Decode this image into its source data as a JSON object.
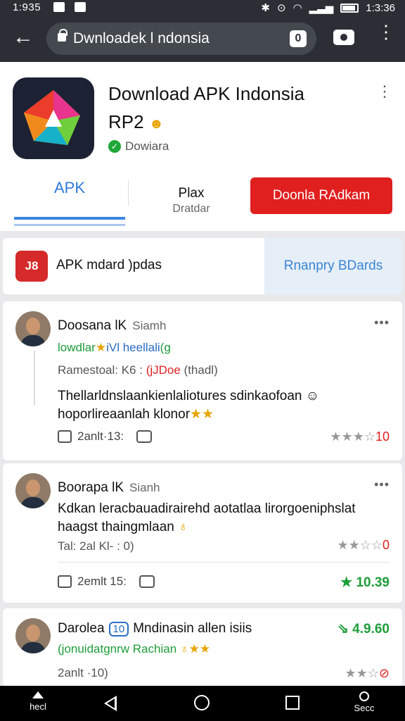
{
  "status_bar": {
    "time_left": "1:935",
    "time_right": "1:3:36"
  },
  "browser": {
    "url": "Dwnloadek l ndonsia",
    "tab_count": "0"
  },
  "app": {
    "title": "Download APK Indonsia",
    "subtitle": "RP2",
    "verified": "Dowiara",
    "tab_apk": "APK",
    "tab_mid_1": "Plax",
    "tab_mid_2": "Dratdar",
    "download_label": "Doonla RAdkam"
  },
  "update": {
    "icon_text": "J8",
    "text": "APK mdard )pdas",
    "action": "Rnanpry BDards"
  },
  "reviews": [
    {
      "name": "Doosana lK",
      "sub": "Siamh",
      "tag_green": "lowdlar",
      "tag_star": "★",
      "tag_blue": "iVl heellali",
      "tag_end": "(g",
      "meta": "Ramestoal: K6 :",
      "meta_red": "(jJDoe",
      "meta_end": "thadl)",
      "body": "Thellarldnslaankienlaliotures sdinkaofoan ☺ hoporlireaanlah klonor",
      "body_stars": "★★",
      "time": "2anlt·13:",
      "stars": "★★★☆",
      "score": "10"
    },
    {
      "name": "Boorapa lK",
      "sub": "Sianh",
      "body": "Kdkan leracbauadirairehd aotatlaa lirorgoeniphslat haagst thaingmlaan",
      "body_emoji": "♁",
      "time1": "Tal: 2al Kl- : 0)",
      "stars": "★★☆☆",
      "score_red": "0",
      "time2": "2emlt 15:",
      "green": "★ 10.39"
    },
    {
      "name": "Darolea",
      "badge": "10",
      "name_end": "Mndinasin allen isiis",
      "tag": "(jonuidatgnrw Rachian",
      "tag_emoji": "♁",
      "tag_stars": "★★",
      "green": "⇘ 4.9.60",
      "time": "2anlt ·10)",
      "stars": "★★☆",
      "score_red": "⊘"
    }
  ],
  "nav": {
    "home_label": "hecl",
    "search_label": "Secc"
  }
}
